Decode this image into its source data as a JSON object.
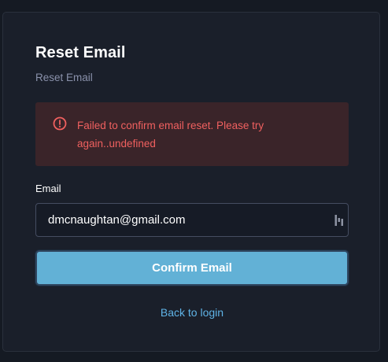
{
  "card": {
    "title": "Reset Email",
    "subtitle": "Reset Email"
  },
  "alert": {
    "icon": "alert-circle-icon",
    "message": "Failed to confirm email reset. Please try again..undefined",
    "color": "#f0605f",
    "background": "#3a2429"
  },
  "email_field": {
    "label": "Email",
    "value": "dmcnaughtan@gmail.com",
    "icon": "password-manager-icon"
  },
  "confirm_button": {
    "label": "Confirm Email",
    "color": "#62b1d6"
  },
  "back_link": {
    "label": "Back to login",
    "color": "#5fb3e6"
  }
}
